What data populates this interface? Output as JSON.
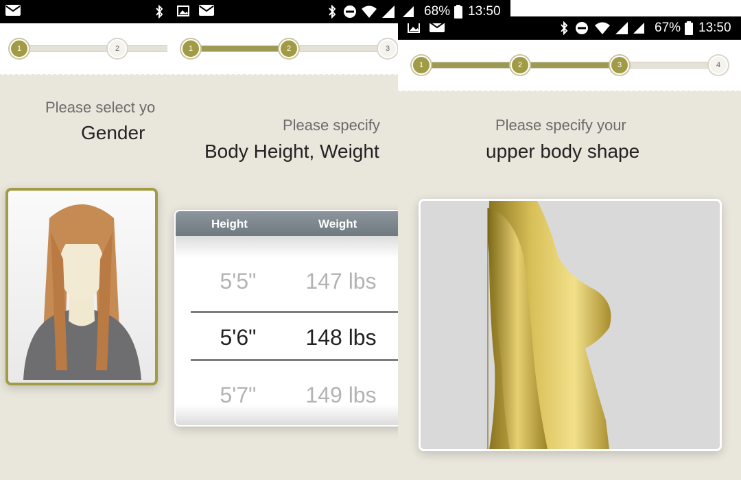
{
  "panels": [
    {
      "status": {
        "time": "",
        "battery": ""
      },
      "steps": [
        "1",
        "2"
      ],
      "prompt": "Please select yo",
      "headline": "Gender"
    },
    {
      "status": {
        "battery": "68%",
        "time": "13:50"
      },
      "steps": [
        "1",
        "2",
        "3"
      ],
      "prompt": "Please specify",
      "headline": "Body Height, Weight",
      "picker": {
        "headers": {
          "height": "Height",
          "weight": "Weight"
        },
        "rows": [
          {
            "height": "5'5\"",
            "weight": "147 lbs"
          },
          {
            "height": "5'6\"",
            "weight": "148 lbs"
          },
          {
            "height": "5'7\"",
            "weight": "149 lbs"
          }
        ]
      }
    },
    {
      "status": {
        "battery": "67%",
        "time": "13:50"
      },
      "steps": [
        "1",
        "2",
        "3",
        "4"
      ],
      "prompt": "Please specify your",
      "headline": "upper body shape"
    }
  ],
  "colors": {
    "accent": "#a19b45",
    "background": "#e9e6dc",
    "status_bar": "#000000"
  }
}
